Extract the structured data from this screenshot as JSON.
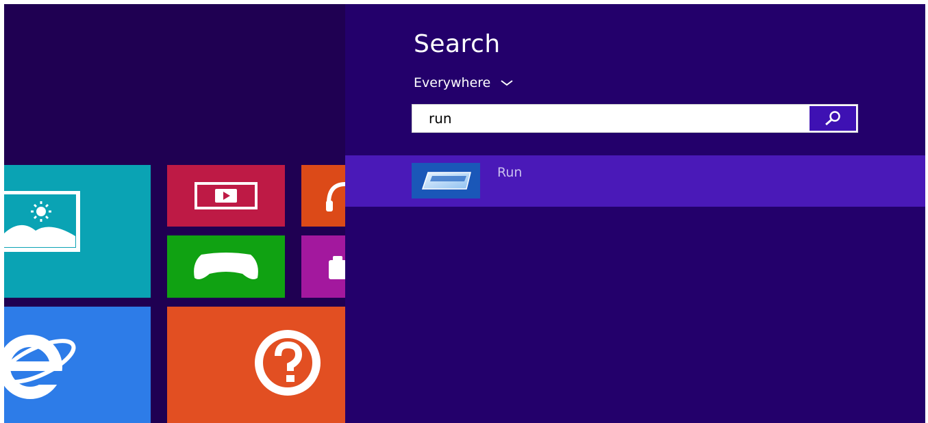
{
  "start_screen": {
    "tiles": [
      {
        "name": "photos",
        "label": "",
        "color": "#0aa3b4"
      },
      {
        "name": "video",
        "label": "",
        "color": "#be1a45"
      },
      {
        "name": "music",
        "label": "",
        "color": "#dc4a18"
      },
      {
        "name": "games",
        "label": "",
        "color": "#10a212"
      },
      {
        "name": "camera",
        "label": "",
        "color": "#a3189e"
      },
      {
        "name": "internet-explorer",
        "label": "",
        "color": "#2d7ce8"
      },
      {
        "name": "help-tips",
        "label": "",
        "color": "#e24f22"
      }
    ]
  },
  "search": {
    "title": "Search",
    "scope": "Everywhere",
    "query": "run",
    "accent": "#3e11b3",
    "pane_color": "#23006b",
    "results": [
      {
        "label": "Run",
        "icon": "run-app-icon",
        "highlight": "#4a19b8"
      }
    ]
  }
}
